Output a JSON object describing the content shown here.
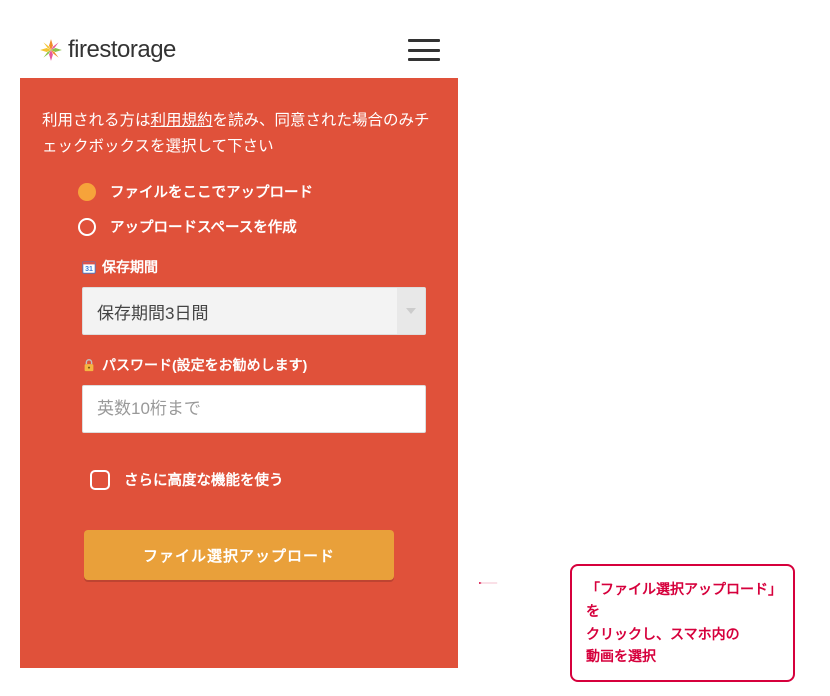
{
  "header": {
    "logo_text": "firestorage"
  },
  "intro": {
    "prefix": "利用される方は",
    "tos": "利用規約",
    "suffix": "を読み、同意された場合のみチェックボックスを選択して下さい"
  },
  "radios": {
    "opt1": "ファイルをここでアップロード",
    "opt2": "アップロードスペースを作成"
  },
  "retention": {
    "label": "保存期間",
    "value": "保存期間3日間"
  },
  "password": {
    "label": "パスワード(設定をお勧めします)",
    "placeholder": "英数10桁まで"
  },
  "advanced": {
    "label": "さらに高度な機能を使う"
  },
  "upload_button": "ファイル選択アップロード",
  "callout": {
    "line1": "「ファイル選択アップロード」を",
    "line2": "クリックし、スマホ内の",
    "line3": "動画を選択"
  }
}
